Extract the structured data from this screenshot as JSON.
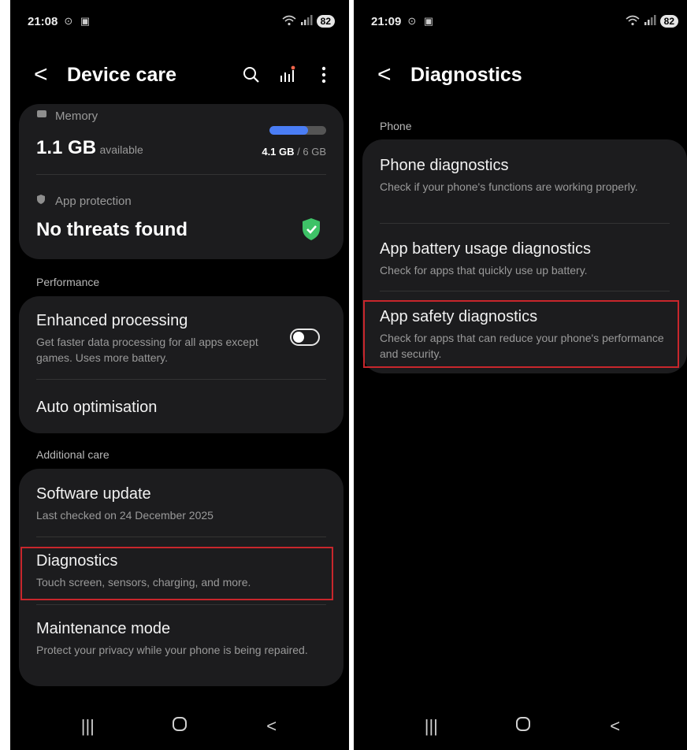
{
  "left": {
    "status": {
      "time": "21:08",
      "left_icons": "⊙ ▣",
      "battery": "82"
    },
    "header": {
      "back": "<",
      "title": "Device care"
    },
    "memory": {
      "label": "Memory",
      "value": "1.1 GB",
      "value_suffix": "available",
      "used": "4.1 GB",
      "total": " / 6 GB",
      "usage_fraction": 0.68
    },
    "protection": {
      "label": "App protection",
      "status": "No threats found"
    },
    "performance": {
      "label": "Performance",
      "items": [
        {
          "title": "Enhanced processing",
          "subtitle": "Get faster data processing for all apps except games. Uses more battery.",
          "toggle_on": false
        },
        {
          "title": "Auto optimisation"
        }
      ]
    },
    "additional": {
      "label": "Additional care",
      "items": [
        {
          "title": "Software update",
          "subtitle": "Last checked on 24 December 2025"
        },
        {
          "title": "Diagnostics",
          "subtitle": "Touch screen, sensors, charging, and more."
        },
        {
          "title": "Maintenance mode",
          "subtitle": "Protect your privacy while your phone is being repaired."
        }
      ]
    }
  },
  "right": {
    "status": {
      "time": "21:09",
      "left_icons": "⊙ ▣",
      "battery": "82"
    },
    "header": {
      "back": "<",
      "title": "Diagnostics"
    },
    "phone": {
      "label": "Phone",
      "items": [
        {
          "title": "Phone diagnostics",
          "subtitle": "Check if your phone's functions are working properly."
        },
        {
          "title": "App battery usage diagnostics",
          "subtitle": "Check for apps that quickly use up battery."
        },
        {
          "title": "App safety diagnostics",
          "subtitle": "Check for apps that can reduce your phone's performance and security."
        }
      ]
    }
  },
  "nav": {
    "recents": "|||",
    "home": "○",
    "back": "<"
  },
  "colors": {
    "highlight": "#c8262c",
    "accent": "#4a7df5",
    "shield": "#3ec267"
  },
  "icons": [
    "search-icon",
    "stats-icon",
    "more-icon",
    "memory-icon",
    "shield-icon",
    "check-icon"
  ]
}
